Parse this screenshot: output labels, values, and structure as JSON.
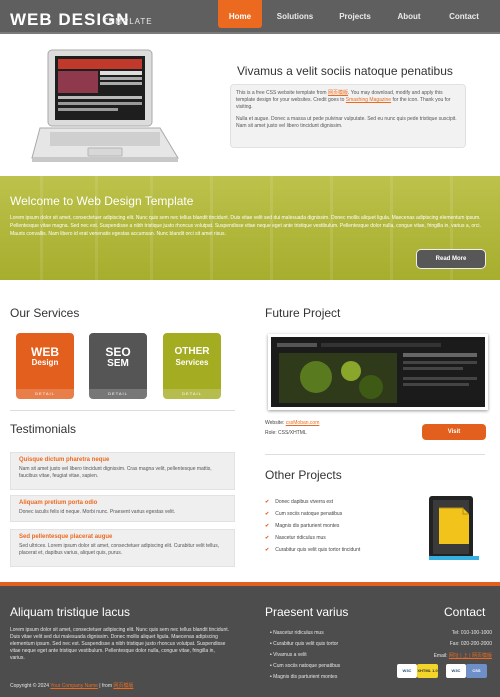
{
  "header": {
    "logo": "WEB DESIGN",
    "logo_sub": "TEMPLATE",
    "nav": [
      "Home",
      "Solutions",
      "Projects",
      "About",
      "Contact"
    ]
  },
  "hero": {
    "title": "Vivamus a velit sociis natoque penatibus",
    "p1_a": "This is a free CSS website template from ",
    "p1_link1": "网页模版",
    "p1_b": ". You may download, modify and apply this template design for your websites. Credit goes to ",
    "p1_link2": "Smashing Magazine",
    "p1_c": " for the icon. Thank you for visiting.",
    "p2": "Nulla et augue. Donec a massa ut pede pulvinar vulputate. Sed eu nunc quis pede tristique suscipit. Nam sit amet justo vel libero tincidunt dignissim."
  },
  "welcome": {
    "title": "Welcome to Web Design Template",
    "text": "Lorem ipsum dolor sit amet, consectetuer adipiscing elit. Nunc quis sem nec tellus blandit tincidunt. Duis vitae velit sed dui malesuada dignissim. Donec mollis aliquet ligula. Maecenas adipiscing elementum ipsum. Pellentesque vitae magna. Sed nec est. Suspendisse a nibh tristique justo rhoncus volutpat. Suspendisse vitae neque eget ante tristique vestibulum. Pellentesque dolor nulla, congue vitae, fringilla in, varius a, orci. Mauris convallis. Nam libero id erat venenatis egestas accumsan. Nunc blandit orci sit amet risus.",
    "button": "Read More"
  },
  "services": {
    "title": "Our Services",
    "items": [
      {
        "line1": "WEB",
        "line2": "Design",
        "detail": "DETAIL"
      },
      {
        "line1": "SEO",
        "line2": "SEM",
        "detail": "DETAIL"
      },
      {
        "line1": "OTHER",
        "line2": "Services",
        "detail": "DETAIL"
      }
    ]
  },
  "testimonials": {
    "title": "Testimonials",
    "items": [
      {
        "heading": "Quisque dictum pharetra neque",
        "body": "Nam sit amet justo vel libero tincidunt dignissim. Cras magna velit, pellentesque mattis, faucibus vitae, feugiat vitae, sapien."
      },
      {
        "heading": "Aliquam pretium porta odio",
        "body": "Donec iaculis felis id neque. Morbi nunc. Praesent varius egestas velit."
      },
      {
        "heading": "Sed pellentesque placerat augue",
        "body": "Sed ultrices. Lorem ipsum dolor sit amet, consectetuer adipiscing elit. Curabitur velit tellus, placerat et, dapibus varius, aliquet quis, purus."
      }
    ]
  },
  "future": {
    "title": "Future Project",
    "website_label": "Website: ",
    "website_link": "cssMoban.com",
    "role": "Role: CSS/XHTML",
    "button": "Visit"
  },
  "other_projects": {
    "title": "Other Projects",
    "items": [
      "Donec dapibus viverra est",
      "Cum sociis natoque penatibus",
      "Magnis dis parturient montes",
      "Nascetur ridiculus mus",
      "Curabitur quis velit quis tortor tincidunt"
    ]
  },
  "footer": {
    "about_title": "Aliquam tristique lacus",
    "about_text": "Lorem ipsum dolor sit amet, consectetuer adipiscing elit. Nunc quis sem nec tellus blandit tincidunt. Duis vitae velit sed dui malesuada dignissim. Donec mollis aliquet ligula. Maecenas adipiscing elementum ipsum. Sed nec est. Suspendisse a nibh tristique justo rhoncus volutpat. Suspendisse vitae neque eget ante tristique vestibulum. Pellentesque dolor nulla, congue vitae, fringilla in, varius.",
    "copyright_a": "Copyright © 2024 ",
    "copyright_link1": "Your Company Name",
    "copyright_b": " | from ",
    "copyright_link2": "网页模版",
    "projects_title": "Praesent varius",
    "projects": [
      "Nascetur ridiculus mus",
      "Curabitur quis velit quis tortor",
      "Vivamus a velit",
      "Cum sociis natoque penatibus",
      "Magnis dis parturient montes"
    ],
    "contact_title": "Contact",
    "tel": "Tel: 010-100-1000",
    "fax": "Fax: 020-200-2000",
    "email_label": "Email: ",
    "email_link": "网址 | 上 | 网页模版",
    "badges": [
      "W3C",
      "XHTML 1.0",
      "W3C",
      "CSS"
    ]
  },
  "colors": {
    "accent": "#ec6a1f",
    "header": "#5f5f5f",
    "welcome": "#aeb535",
    "footer": "#4d4d4d"
  }
}
